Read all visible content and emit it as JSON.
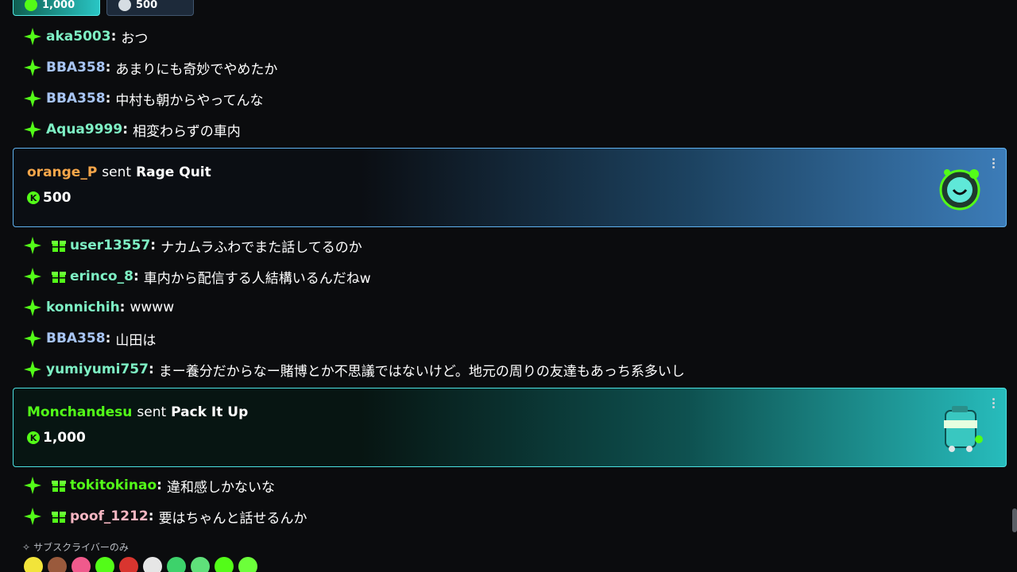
{
  "top_tiles": [
    {
      "amount": "1,000",
      "coin": "green-coin-icon"
    },
    {
      "amount": "500",
      "coin": "silver-coin-icon"
    }
  ],
  "messages_a": [
    {
      "user": "aka5003",
      "color": "#7ef0c4",
      "gift": false,
      "text": "おつ"
    },
    {
      "user": "BBA358",
      "color": "#a7c4f2",
      "gift": false,
      "text": "あまりにも奇妙でやめたか"
    },
    {
      "user": "BBA358",
      "color": "#a7c4f2",
      "gift": false,
      "text": "中村も朝からやってんな"
    },
    {
      "user": "Aqua9999",
      "color": "#7ef0c4",
      "gift": false,
      "text": "相変わらずの車内"
    }
  ],
  "gift_1": {
    "sender": "orange_P",
    "sender_color": "#f6a64a",
    "verb": "sent",
    "item": "Rage Quit",
    "amount": "500"
  },
  "messages_b": [
    {
      "user": "user13557",
      "color": "#7ef0c4",
      "gift": true,
      "text": "ナカムラふわでまた話してるのか"
    },
    {
      "user": "erinco_8",
      "color": "#7ef0c4",
      "gift": true,
      "text": "車内から配信する人結構いるんだねw"
    },
    {
      "user": "konnichih",
      "color": "#7ef0c4",
      "gift": false,
      "text": "wwww"
    },
    {
      "user": "BBA358",
      "color": "#a7c4f2",
      "gift": false,
      "text": "山田は"
    },
    {
      "user": "yumiyumi757",
      "color": "#7ef0c4",
      "gift": false,
      "text": "まー養分だからなー賭博とか不思議ではないけど。地元の周りの友達もあっち系多いし"
    }
  ],
  "gift_2": {
    "sender": "Monchandesu",
    "sender_color": "#53fc18",
    "verb": "sent",
    "item": "Pack It Up",
    "amount": "1,000"
  },
  "messages_c": [
    {
      "user": "tokitokinao",
      "color": "#53fc18",
      "gift": true,
      "text": "違和感しかないな"
    },
    {
      "user": "poof_1212",
      "color": "#f7b6c2",
      "gift": true,
      "text": "要はちゃんと話せるんか"
    }
  ],
  "subscriber_only_label": "サブスクライバーのみ",
  "emotes": [
    "yellow-face-emote",
    "man-face-emote",
    "pink-cat-emote",
    "angel-emote",
    "angry-red-emote",
    "skull-emote",
    "green-grin-emote",
    "green-wink-emote",
    "green-frog-emote",
    "green-blob-emote"
  ],
  "colors": {
    "brand_green": "#53fc18",
    "orange_card": "#3c7cb8",
    "teal_card": "#27bcbc"
  }
}
